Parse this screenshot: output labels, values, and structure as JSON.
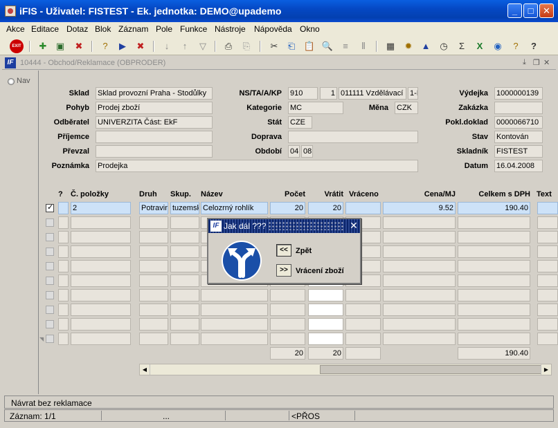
{
  "window": {
    "title": "iFIS - Uživatel: FISTEST - Ek. jednotka: DEMO@upademo",
    "minimize": "_",
    "maximize": "□",
    "close": "✕"
  },
  "menu": [
    "Akce",
    "Editace",
    "Dotaz",
    "Blok",
    "Záznam",
    "Pole",
    "Funkce",
    "Nástroje",
    "Nápověda",
    "Okno"
  ],
  "toolbar": {
    "exit_label": "EXIT"
  },
  "form": {
    "title": "10444 - Obchod/Reklamace (OBPRODER)",
    "logo": "IF",
    "nav_label": "Nav"
  },
  "header": {
    "sklad": {
      "label": "Sklad",
      "value": "Sklad provozní Praha - Stodůlky"
    },
    "pohyb": {
      "label": "Pohyb",
      "value": "Prodej zboží"
    },
    "odberatel": {
      "label": "Odběratel",
      "value": "UNIVERZITA Část: EkF"
    },
    "prijemce": {
      "label": "Příjemce",
      "value": ""
    },
    "prevzal": {
      "label": "Převzal",
      "value": ""
    },
    "poznamka": {
      "label": "Poznámka",
      "value": "Prodejka"
    },
    "ns_ta": {
      "label": "NS/TA/A/KP",
      "v1": "910",
      "v2": "1",
      "v3": "011111 Vzdělávací",
      "v4": "1-I"
    },
    "kategorie": {
      "label": "Kategorie",
      "value": "MC"
    },
    "mena": {
      "label": "Měna",
      "value": "CZK"
    },
    "stat": {
      "label": "Stát",
      "value": "CZE"
    },
    "doprava": {
      "label": "Doprava",
      "value": ""
    },
    "obdobi": {
      "label": "Období",
      "v1": "04",
      "v2": "08"
    },
    "vydejka": {
      "label": "Výdejka",
      "value": "1000000139"
    },
    "zakazka": {
      "label": "Zakázka",
      "value": ""
    },
    "pokl_doklad": {
      "label": "Pokl.doklad",
      "value": "0000066710"
    },
    "stav": {
      "label": "Stav",
      "value": "Kontován"
    },
    "skladnik": {
      "label": "Skladník",
      "value": "FISTEST"
    },
    "datum": {
      "label": "Datum",
      "value": "16.04.2008"
    }
  },
  "grid": {
    "columns": [
      "?",
      "Č. položky",
      "Druh",
      "Skup.",
      "Název",
      "Počet",
      "Vrátit",
      "Vráceno",
      "Cena/MJ",
      "Celkem s DPH",
      "Text"
    ],
    "rows": [
      {
        "checked": true,
        "polozka": "2",
        "druh": "Potravin",
        "skup": "tuzemsk",
        "nazev": "Celozrný rohlík",
        "pocet": "20",
        "vratit": "20",
        "vraceno": "",
        "cena": "9.52",
        "celkem": "190.40"
      }
    ],
    "totals": {
      "pocet": "20",
      "vratit": "20",
      "celkem": "190.40"
    }
  },
  "dialog": {
    "title": "Jak dál ???",
    "logo": "IF",
    "close": "✕",
    "back_button": "<<",
    "back_label": "Zpět",
    "next_button": ">>",
    "next_label": "Vrácení zboží"
  },
  "status": {
    "message": "Návrat bez reklamace",
    "record": "Záznam: 1/1",
    "cell2": "...",
    "cell3": "<PŘOS"
  }
}
